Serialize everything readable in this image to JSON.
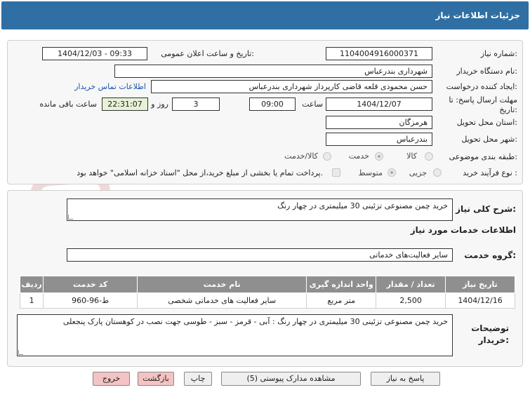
{
  "header": {
    "title": "جزئیات اطلاعات نیاز"
  },
  "form": {
    "need_number_label": "شماره نیاز:",
    "need_number": "1104004916000371",
    "announce_label": "تاریخ و ساعت اعلان عمومی:",
    "announce_value": "1404/12/03 - 09:33",
    "buyer_org_label": "نام دستگاه خریدار:",
    "buyer_org": "شهرداری بندرعباس",
    "creator_label": "ایجاد کننده درخواست:",
    "creator": "حسن محمودی قلعه قاضی کارپرداز شهرداری بندرعباس",
    "contact_link": "اطلاعات تماس خریدار",
    "deadline_label": "مهلت ارسال پاسخ: تا تاریخ:",
    "deadline_date": "1404/12/07",
    "time_label": "ساعت",
    "deadline_time": "09:00",
    "days_count": "3",
    "days_label": "روز و",
    "remaining_time": "22:31:07",
    "remaining_label": "ساعت باقی مانده",
    "province_label": "استان محل تحویل:",
    "province": "هرمزگان",
    "city_label": "شهر محل تحویل:",
    "city": "بندرعباس",
    "category_label": "طبقه بندی موضوعی:",
    "category_options": [
      "کالا",
      "خدمت",
      "کالا/خدمت"
    ],
    "process_label": "نوع فرآیند خرید :",
    "process_options": [
      "جزیی",
      "متوسط"
    ],
    "payment_note": "پرداخت تمام یا بخشی از مبلغ خرید،از محل \"اسناد خزانه اسلامی\" خواهد بود."
  },
  "summary": {
    "label": "شرح کلی نیاز:",
    "text": "خرید چمن مصنوعی تزئینی 30 میلیمتری در چهار رنگ"
  },
  "services": {
    "section_title": "اطلاعات خدمات مورد نیاز",
    "group_label": "گروه خدمت:",
    "group_value": "سایر فعالیت‌های خدماتی",
    "columns": [
      "ردیف",
      "کد خدمت",
      "نام خدمت",
      "واحد اندازه گیری",
      "تعداد / مقدار",
      "تاریخ نیاز"
    ],
    "rows": [
      [
        "1",
        "ط-96-960",
        "سایر فعالیت های خدماتی شخصی",
        "متر مربع",
        "2,500",
        "1404/12/16"
      ]
    ]
  },
  "notes": {
    "label_line1": "توضیحات",
    "label_line2": "خریدار:",
    "text": "خرید چمن مصنوعی تزئینی 30 میلیمتری در چهار رنگ : آبی - قرمز - سبز - طوسی جهت نصب در کوهستان پارک پنجعلی"
  },
  "buttons": {
    "reply": "پاسخ به نیاز",
    "attachments": "مشاهده مدارک پیوستی (5)",
    "print": "چاپ",
    "back": "بازگشت",
    "exit": "خروج"
  },
  "watermark": {
    "text": "AriaTender.net"
  },
  "colors": {
    "header_bg": "#2f6fa3",
    "remaining_bg": "#e6f1d6",
    "exit_bg": "#f4c3c3",
    "link": "#1a56b0"
  }
}
